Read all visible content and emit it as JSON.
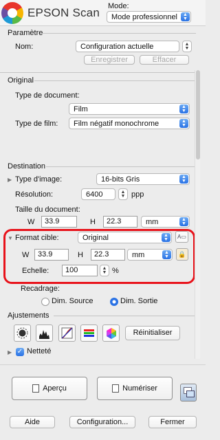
{
  "header": {
    "app_title": "EPSON Scan",
    "mode_label": "Mode:",
    "mode_value": "Mode professionnel"
  },
  "parametre": {
    "title": "Paramètre",
    "name_label": "Nom:",
    "name_value": "Configuration actuelle",
    "save_label": "Enregistrer",
    "delete_label": "Effacer"
  },
  "original": {
    "title": "Original",
    "doc_type_label": "Type de document:",
    "doc_type_value": "Film",
    "film_type_label": "Type de film:",
    "film_type_value": "Film négatif monochrome"
  },
  "destination": {
    "title": "Destination",
    "image_type_label": "Type d'image:",
    "image_type_value": "16-bits Gris",
    "resolution_label": "Résolution:",
    "resolution_value": "6400",
    "resolution_unit": "ppp",
    "doc_size_label": "Taille du document:",
    "w_label": "W",
    "w_value": "33.9",
    "h_label": "H",
    "h_value": "22.3",
    "unit_value": "mm"
  },
  "target": {
    "format_label": "Format cible:",
    "format_value": "Original",
    "w_label": "W",
    "w_value": "33.9",
    "h_label": "H",
    "h_value": "22.3",
    "unit_value": "mm",
    "scale_label": "Echelle:",
    "scale_value": "100",
    "scale_unit": "%",
    "trim_label": "Recadrage:",
    "radio_source": "Dim. Source",
    "radio_output": "Dim. Sortie"
  },
  "ajustements": {
    "title": "Ajustements",
    "reset_label": "Réinitialiser",
    "sharpness_label": "Netteté"
  },
  "footer": {
    "preview_label": "Aperçu",
    "scan_label": "Numériser",
    "help_label": "Aide",
    "config_label": "Configuration...",
    "close_label": "Fermer"
  },
  "colors": {
    "accent": "#2a72e5",
    "highlight": "#e8121a"
  }
}
